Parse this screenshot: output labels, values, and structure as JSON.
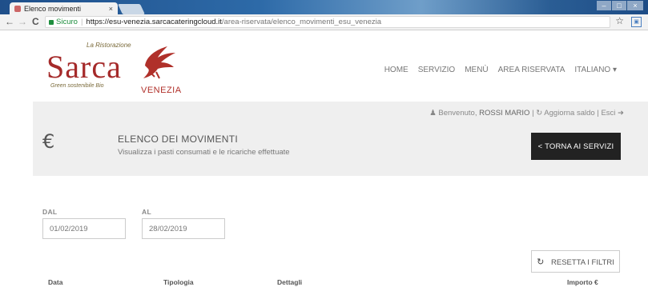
{
  "browser": {
    "tab_title": "Elenco movimenti",
    "tab_close": "×",
    "secure_label": "Sicuro",
    "url_host": "https://esu-venezia.sarcacateringcloud.it",
    "url_path": "/area-riservata/elenco_movimenti_esu_venezia",
    "back": "←",
    "forward": "→",
    "reload": "C",
    "star": "☆"
  },
  "logo": {
    "tagline": "La Ristorazione",
    "brand": "Sarca",
    "sub": "Green sostenibile Bio",
    "city": "VENEZIA"
  },
  "menu": {
    "items": [
      "HOME",
      "SERVIZIO",
      "MENÙ",
      "AREA RISERVATA",
      "ITALIANO ▾"
    ]
  },
  "userbar": {
    "greeting": "Benvenuto,",
    "name": "ROSSI MARIO",
    "refresh": "Aggiorna saldo",
    "logout": "Esci"
  },
  "banner": {
    "title": "ELENCO DEI MOVIMENTI",
    "subtitle": "Visualizza i pasti consumati e le ricariche effettuate",
    "back_button": "< TORNA AI SERVIZI"
  },
  "filters": {
    "from_label": "DAL",
    "from_value": "01/02/2019",
    "to_label": "AL",
    "to_value": "28/02/2019",
    "reset_label": "RESETTA I FILTRI"
  },
  "table": {
    "columns": [
      "Data",
      "Tipologia",
      "Dettagli",
      "Importo €"
    ]
  }
}
